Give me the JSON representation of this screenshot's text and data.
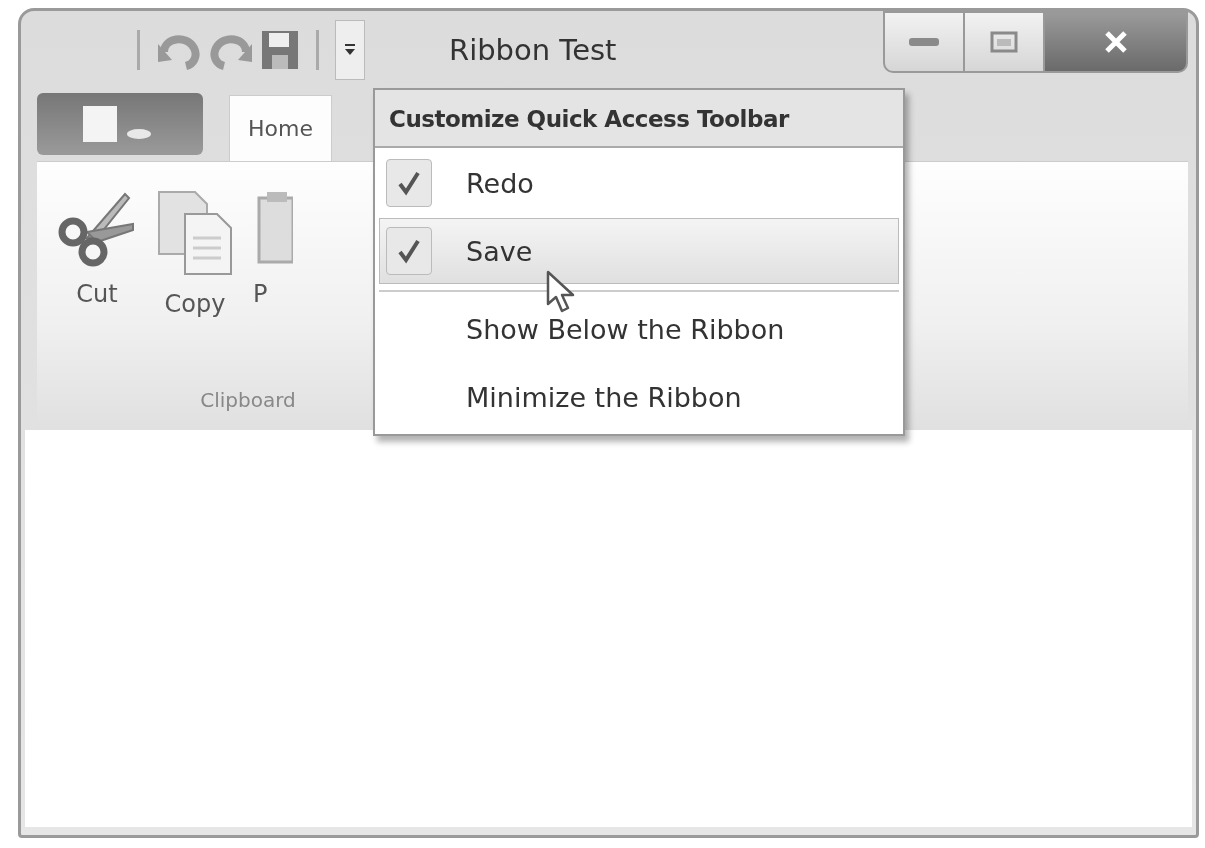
{
  "window": {
    "title": "Ribbon Test"
  },
  "quick_access": {
    "menu_open": true
  },
  "ribbon": {
    "tabs": [
      {
        "label": "Home",
        "selected": true
      }
    ],
    "groups": [
      {
        "label": "Clipboard",
        "buttons": [
          {
            "label": "Cut",
            "kind": "cut"
          },
          {
            "label": "Copy",
            "kind": "copy"
          },
          {
            "label": "P",
            "kind": "paste"
          }
        ]
      }
    ]
  },
  "menu": {
    "title": "Customize Quick Access Toolbar",
    "items": [
      {
        "label": "Redo",
        "kind": "check",
        "checked": true,
        "selected": false
      },
      {
        "label": "Save",
        "kind": "check",
        "checked": true,
        "selected": true
      },
      {
        "kind": "separator"
      },
      {
        "label": "Show Below the Ribbon",
        "kind": "plain",
        "selected": false
      },
      {
        "label": "Minimize the Ribbon",
        "kind": "plain",
        "selected": false
      }
    ]
  }
}
